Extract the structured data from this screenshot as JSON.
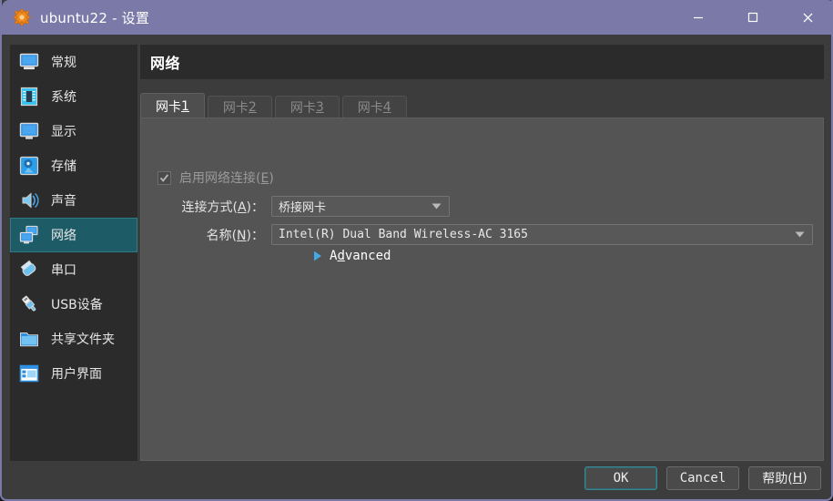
{
  "window": {
    "title": "ubuntu22 - 设置",
    "app_icon": "gear-icon",
    "controls": {
      "minimize": "minimize-icon",
      "maximize": "maximize-icon",
      "close": "close-icon"
    },
    "titlebar_color": "#7b79a8",
    "accent_color": "#1d5b66"
  },
  "sidebar": {
    "items": [
      {
        "label": "常规",
        "icon": "monitor-icon",
        "selected": false
      },
      {
        "label": "系统",
        "icon": "chip-icon",
        "selected": false
      },
      {
        "label": "显示",
        "icon": "display-icon",
        "selected": false
      },
      {
        "label": "存储",
        "icon": "harddisk-icon",
        "selected": false
      },
      {
        "label": "声音",
        "icon": "speaker-icon",
        "selected": false
      },
      {
        "label": "网络",
        "icon": "network-icon",
        "selected": true
      },
      {
        "label": "串口",
        "icon": "serialport-icon",
        "selected": false
      },
      {
        "label": "USB设备",
        "icon": "usb-icon",
        "selected": false
      },
      {
        "label": "共享文件夹",
        "icon": "folder-icon",
        "selected": false
      },
      {
        "label": "用户界面",
        "icon": "interface-icon",
        "selected": false
      }
    ]
  },
  "main": {
    "page_title": "网络",
    "tabs": [
      {
        "label_prefix": "网卡 ",
        "mnemonic": "1",
        "active": true
      },
      {
        "label_prefix": "网卡 ",
        "mnemonic": "2",
        "active": false
      },
      {
        "label_prefix": "网卡 ",
        "mnemonic": "3",
        "active": false
      },
      {
        "label_prefix": "网卡 ",
        "mnemonic": "4",
        "active": false
      }
    ],
    "enable_checkbox": {
      "label_before": "启用网络连接(",
      "mnemonic": "E",
      "label_after": ")",
      "checked": true,
      "disabled": true
    },
    "fields": [
      {
        "label_before": "连接方式(",
        "mnemonic": "A",
        "label_after": ")：",
        "value": "桥接网卡"
      },
      {
        "label_before": "名称(",
        "mnemonic": "N",
        "label_after": ")：",
        "value": "Intel(R) Dual Band Wireless-AC 3165"
      }
    ],
    "advanced": {
      "label_before": "A",
      "mnemonic": "d",
      "label_after": "vanced",
      "expanded": false,
      "arrow_color": "#45a8e8"
    }
  },
  "footer": {
    "ok_label": "OK",
    "cancel_label": "Cancel",
    "help_label_before": "帮助(",
    "help_mnemonic": "H",
    "help_label_after": ")"
  }
}
